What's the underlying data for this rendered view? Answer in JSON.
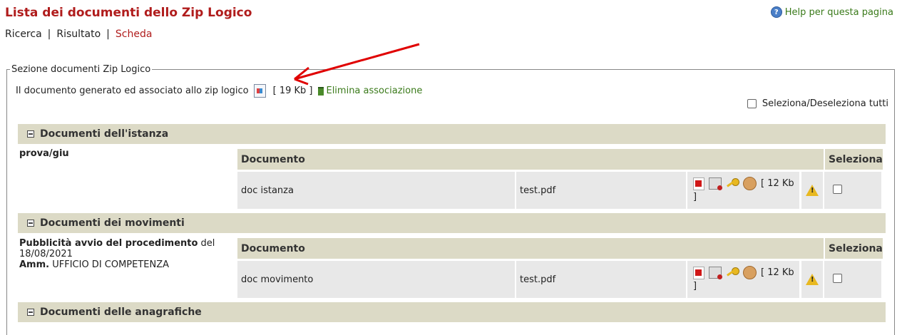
{
  "page": {
    "title": "Lista dei documenti dello Zip Logico",
    "help": "Help per questa pagina"
  },
  "breadcrumb": {
    "ricerca": "Ricerca",
    "risultato": "Risultato",
    "scheda": "Scheda",
    "separator": "|"
  },
  "section": {
    "legend": "Sezione documenti Zip Logico",
    "generated_text": "Il documento generato ed associato allo zip logico",
    "generated_size": "[ 19 Kb ]",
    "delete_label": "Elimina associazione",
    "select_all": "Seleziona/Deseleziona tutti"
  },
  "groups": [
    {
      "header": "Documenti dell'istanza",
      "label_bold": "prova/giu",
      "table": {
        "col_doc": "Documento",
        "col_sel": "Seleziona",
        "row": {
          "name": "doc istanza",
          "file": "test.pdf",
          "size": "[ 12 Kb ]"
        }
      }
    },
    {
      "header": "Documenti dei movimenti",
      "label_bold": "Pubblicità avvio del procedimento",
      "label_rest": " del 18/08/2021",
      "label2_bold": "Amm.",
      "label2_rest": " UFFICIO DI COMPETENZA",
      "table": {
        "col_doc": "Documento",
        "col_sel": "Seleziona",
        "row": {
          "name": "doc movimento",
          "file": "test.pdf",
          "size": "[ 12 Kb ]"
        }
      }
    },
    {
      "header": "Documenti delle anagrafiche"
    }
  ],
  "colors": {
    "title": "#b01c1c",
    "link_green": "#3a7a1a",
    "header_bg": "#dcdac6",
    "cell_bg": "#e8e8e8",
    "annotation_arrow": "#e00000"
  },
  "icons": [
    "help-icon",
    "document-icon",
    "trash-icon",
    "pdf-icon",
    "signature-icon",
    "key-icon",
    "seal-icon",
    "warning-icon",
    "minus-icon"
  ]
}
